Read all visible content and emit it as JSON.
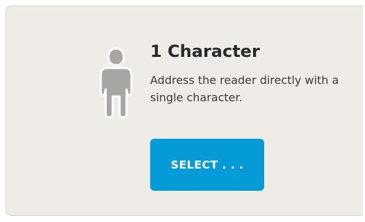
{
  "card": {
    "title": "1 Character",
    "description": "Address the reader directly with a single character.",
    "icon": "person-figure-icon",
    "select_label": "SELECT . . ."
  },
  "colors": {
    "card_background": "#efebe7",
    "button_background": "#049bd7",
    "button_text": "#ffffff",
    "icon_fill": "#a8a6a3"
  }
}
